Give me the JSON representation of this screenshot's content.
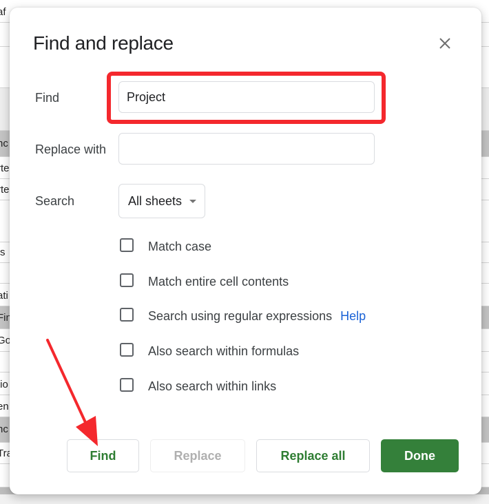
{
  "background_sheet": {
    "rows": [
      {
        "text": "af",
        "shaded": false
      },
      {
        "text": "",
        "shaded": false
      },
      {
        "text": "",
        "shaded": false
      },
      {
        "text": "",
        "shaded": false
      },
      {
        "text": "nc",
        "shaded": true
      },
      {
        "text": "rte",
        "shaded": false
      },
      {
        "text": "rte",
        "shaded": false
      },
      {
        "text": "",
        "shaded": false
      },
      {
        "text": "s",
        "shaded": false
      },
      {
        "text": "",
        "shaded": false
      },
      {
        "text": "ati",
        "shaded": false
      },
      {
        "text": "Fin",
        "shaded": true
      },
      {
        "text": "Go",
        "shaded": false
      },
      {
        "text": "",
        "shaded": false
      },
      {
        "text": "tio",
        "shaded": false
      },
      {
        "text": "en",
        "shaded": false
      },
      {
        "text": "nc",
        "shaded": true
      },
      {
        "text": "Tra",
        "shaded": false
      },
      {
        "text": "",
        "shaded": false
      }
    ]
  },
  "dialog": {
    "title": "Find and replace",
    "close_icon": "close-icon",
    "find": {
      "label": "Find",
      "value": "Project",
      "placeholder": ""
    },
    "replace": {
      "label": "Replace with",
      "value": "",
      "placeholder": ""
    },
    "search": {
      "label": "Search",
      "selected": "All sheets"
    },
    "options": [
      {
        "label": "Match case",
        "checked": false
      },
      {
        "label": "Match entire cell contents",
        "checked": false
      },
      {
        "label": "Search using regular expressions",
        "checked": false,
        "link": "Help"
      },
      {
        "label": "Also search within formulas",
        "checked": false
      },
      {
        "label": "Also search within links",
        "checked": false
      }
    ],
    "buttons": {
      "find": "Find",
      "replace": "Replace",
      "replace_all": "Replace all",
      "done": "Done"
    }
  },
  "annotations": {
    "highlight_color": "#f4282d",
    "highlight_target": "find-input",
    "arrow_target": "find-button"
  },
  "colors": {
    "accent_green": "#34803a",
    "link_blue": "#1a62d6"
  }
}
